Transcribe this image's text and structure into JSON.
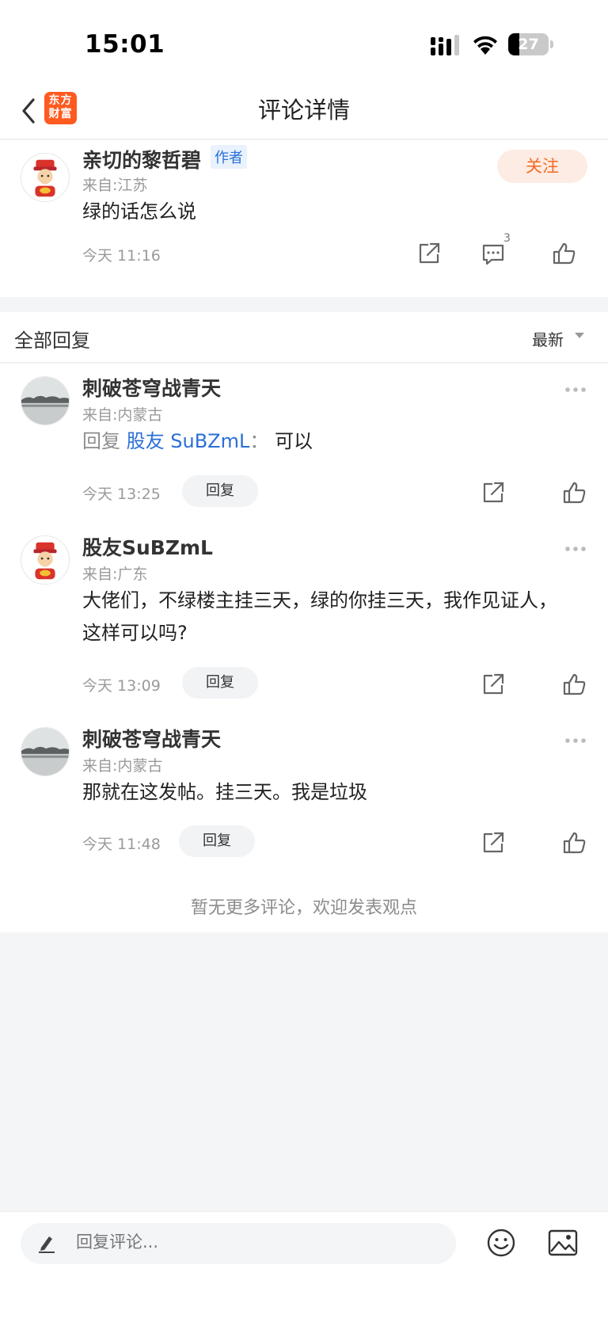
{
  "status_bar": {
    "time": "15:01",
    "battery": "27",
    "battery_level": 0.27
  },
  "nav": {
    "back": "back",
    "logo_line1": "东方",
    "logo_line2": "财富",
    "title": "评论详情"
  },
  "main_comment": {
    "username": "亲切的黎哲碧",
    "author_badge": "作者",
    "location": "来自:江苏",
    "content": "绿的话怎么说",
    "time": "今天 11:16",
    "follow_label": "关注",
    "reply_count": "3"
  },
  "replies_header": {
    "title": "全部回复",
    "sort": "最新"
  },
  "replies": [
    {
      "username": "刺破苍穹战青天",
      "location": "来自:内蒙古",
      "reply_prefix": "回复",
      "mention": "股友 SuBZmL",
      "separator": "：",
      "content": "可以",
      "time": "今天 13:25",
      "reply_label": "回复"
    },
    {
      "username": "股友SuBZmL",
      "location": "来自:广东",
      "content": "大佬们，不绿楼主挂三天，绿的你挂三天，我作见证人，这样可以吗?",
      "time": "今天 13:09",
      "reply_label": "回复"
    },
    {
      "username": "刺破苍穹战青天",
      "location": "来自:内蒙古",
      "content": "那就在这发帖。挂三天。我是垃圾",
      "time": "今天 11:48",
      "reply_label": "回复"
    }
  ],
  "no_more_text": "暂无更多评论，欢迎发表观点",
  "bottom_bar": {
    "placeholder": "回复评论..."
  },
  "colors": {
    "accent_orange": "#ff5a1f",
    "link_blue": "#2a6fd6",
    "follow_bg": "#fdece3"
  }
}
